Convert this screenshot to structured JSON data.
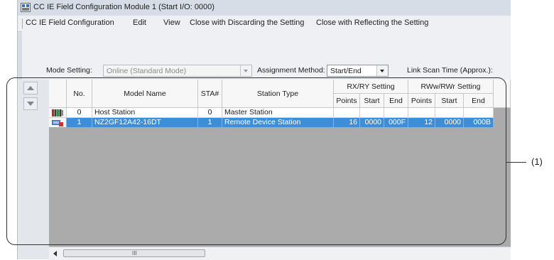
{
  "window": {
    "title": "CC IE Field Configuration Module 1 (Start I/O: 0000)"
  },
  "menu": [
    {
      "label": "CC IE Field Configuration"
    },
    {
      "label": "Edit"
    },
    {
      "label": "View"
    },
    {
      "label": "Close with Discarding the Setting"
    },
    {
      "label": "Close with Reflecting the Setting"
    }
  ],
  "settings": {
    "mode_label": "Mode Setting:",
    "mode_value": "Online (Standard Mode)",
    "assignment_label": "Assignment Method:",
    "assignment_value": "Start/End",
    "scan_label": "Link Scan Time (Approx.):"
  },
  "table": {
    "headers": {
      "no": "No.",
      "model": "Model Name",
      "sta": "STA#",
      "type": "Station Type",
      "rxry": "RX/RY Setting",
      "rwwrwr": "RWw/RWr Setting",
      "points": "Points",
      "start": "Start",
      "end": "End"
    },
    "rows": [
      {
        "icon": "master-station-icon",
        "no": "0",
        "model": "Host Station",
        "sta": "0",
        "type": "Master Station",
        "rx_points": "",
        "rx_start": "",
        "rx_end": "",
        "rw_points": "",
        "rw_start": "",
        "rw_end": "",
        "selected": false
      },
      {
        "icon": "remote-device-station-icon",
        "no": "1",
        "model": "NZ2GF12A42-16DT",
        "sta": "1",
        "type": "Remote Device Station",
        "rx_points": "16",
        "rx_start": "0000",
        "rx_end": "000F",
        "rw_points": "12",
        "rw_start": "0000",
        "rw_end": "000B",
        "selected": true
      }
    ]
  },
  "scrollbar": {
    "thumb_glyph": "III"
  },
  "annotation": {
    "label": "(1)"
  },
  "colors": {
    "selection": "#3d8ed6",
    "grid_background": "#ababab",
    "window_background": "#d9dee5"
  }
}
